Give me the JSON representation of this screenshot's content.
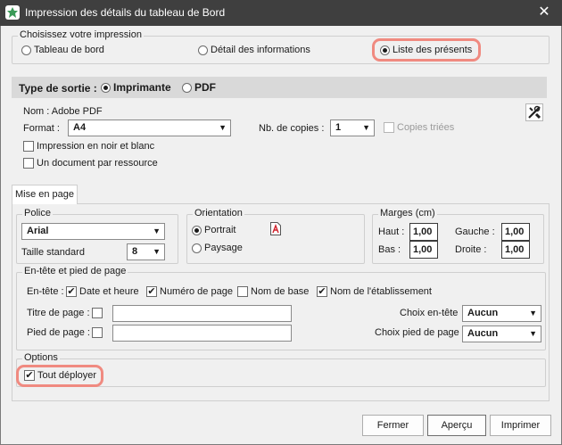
{
  "window": {
    "title": "Impression des détails du tableau de Bord",
    "close_glyph": "✕"
  },
  "impression": {
    "legend": "Choisissez votre impression",
    "options": [
      {
        "label": "Tableau de bord",
        "selected": false
      },
      {
        "label": "Détail des informations",
        "selected": false
      },
      {
        "label": "Liste des présents",
        "selected": true
      }
    ]
  },
  "sortie": {
    "label": "Type de sortie :",
    "options": [
      {
        "label": "Imprimante",
        "selected": true
      },
      {
        "label": "PDF",
        "selected": false
      }
    ],
    "nom": "Nom : Adobe PDF",
    "format_label": "Format :",
    "format_value": "A4",
    "copies_label": "Nb. de copies :",
    "copies_value": "1",
    "copies_triees_label": "Copies triées",
    "noir_blanc_label": "Impression en noir et blanc",
    "par_ressource_label": "Un document par ressource",
    "tools_icon": "tools-icon"
  },
  "tab": {
    "label": "Mise en page"
  },
  "police": {
    "legend": "Police",
    "font_value": "Arial",
    "taille_label": "Taille standard",
    "taille_value": "8"
  },
  "orientation": {
    "legend": "Orientation",
    "options": [
      {
        "label": "Portrait",
        "selected": true
      },
      {
        "label": "Paysage",
        "selected": false
      }
    ],
    "icon": "page-orientation-icon"
  },
  "marges": {
    "legend": "Marges (cm)",
    "haut_label": "Haut :",
    "haut_value": "1,00",
    "gauche_label": "Gauche :",
    "gauche_value": "1,00",
    "bas_label": "Bas :",
    "bas_value": "1,00",
    "droite_label": "Droite :",
    "droite_value": "1,00"
  },
  "entete": {
    "legend": "En-tête et pied de page",
    "entete_label": "En-tête :",
    "checks": [
      {
        "label": "Date et heure",
        "checked": true
      },
      {
        "label": "Numéro de page",
        "checked": true
      },
      {
        "label": "Nom de base",
        "checked": false
      },
      {
        "label": "Nom de l'établissement",
        "checked": true
      }
    ],
    "titre_label": "Titre de page :",
    "pied_label": "Pied de page :",
    "choix_entete_label": "Choix en-tête",
    "choix_entete_value": "Aucun",
    "choix_pied_label": "Choix pied de page",
    "choix_pied_value": "Aucun"
  },
  "options": {
    "legend": "Options",
    "tout_deployer_label": "Tout déployer",
    "tout_deployer_checked": true
  },
  "buttons": {
    "fermer": "Fermer",
    "apercu": "Aperçu",
    "imprimer": "Imprimer"
  },
  "colors": {
    "titlebar": "#3f3f3f",
    "highlight": "#f08a80",
    "band": "#d9d9d9",
    "background": "#f0f0f0"
  }
}
